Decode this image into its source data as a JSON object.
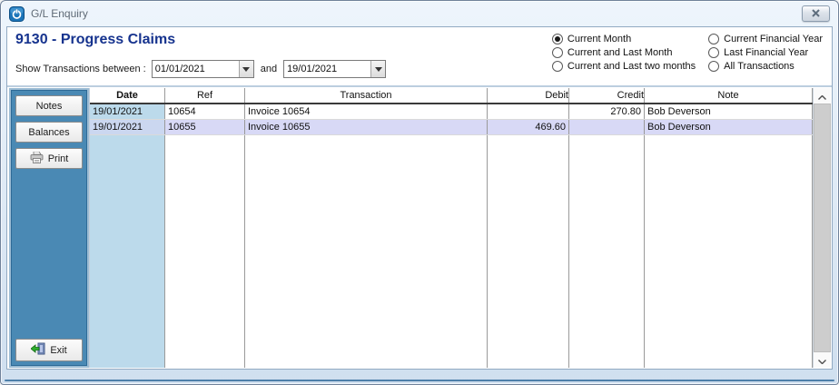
{
  "window": {
    "title": "G/L Enquiry"
  },
  "header": {
    "account_title": "9130 - Progress Claims",
    "filter_label": "Show Transactions between :",
    "date_from": "01/01/2021",
    "conjunction": "and",
    "date_to": "19/01/2021",
    "radio_columns": [
      [
        {
          "label": "Current Month",
          "selected": true
        },
        {
          "label": "Current and Last Month",
          "selected": false
        },
        {
          "label": "Current and Last two months",
          "selected": false
        }
      ],
      [
        {
          "label": "Current Financial Year",
          "selected": false
        },
        {
          "label": "Last Financial Year",
          "selected": false
        },
        {
          "label": "All Transactions",
          "selected": false
        }
      ]
    ]
  },
  "sidebar": {
    "notes_label": "Notes",
    "balances_label": "Balances",
    "print_label": "Print",
    "exit_label": "Exit"
  },
  "table": {
    "columns": [
      {
        "label": "Date",
        "bold": true
      },
      {
        "label": "Ref",
        "bold": false
      },
      {
        "label": "Transaction",
        "bold": false
      },
      {
        "label": "Debit",
        "bold": false
      },
      {
        "label": "Credit",
        "bold": false
      },
      {
        "label": "Note",
        "bold": false
      }
    ],
    "rows": [
      {
        "date": "19/01/2021",
        "ref": "10654",
        "transaction": "Invoice 10654",
        "debit": "",
        "credit": "270.80",
        "note": "Bob Deverson",
        "selected": false
      },
      {
        "date": "19/01/2021",
        "ref": "10655",
        "transaction": "Invoice 10655",
        "debit": "469.60",
        "credit": "",
        "note": "Bob Deverson",
        "selected": true
      }
    ]
  },
  "icons": {
    "app_icon": "power-symbol",
    "close_icon": "x-cross",
    "combo_arrow_icon": "triangle-down",
    "print_icon": "printer",
    "exit_icon": "door-with-green-arrow",
    "scroll_up_icon": "chevron-up",
    "scroll_down_icon": "chevron-down"
  },
  "colors": {
    "accent_title": "#16338e",
    "sidebar_panel": "#4a89b4",
    "date_column": "#bcdaeb",
    "selected_row": "#d8d9f6",
    "selected_date_cell": "#cbd7f0"
  }
}
